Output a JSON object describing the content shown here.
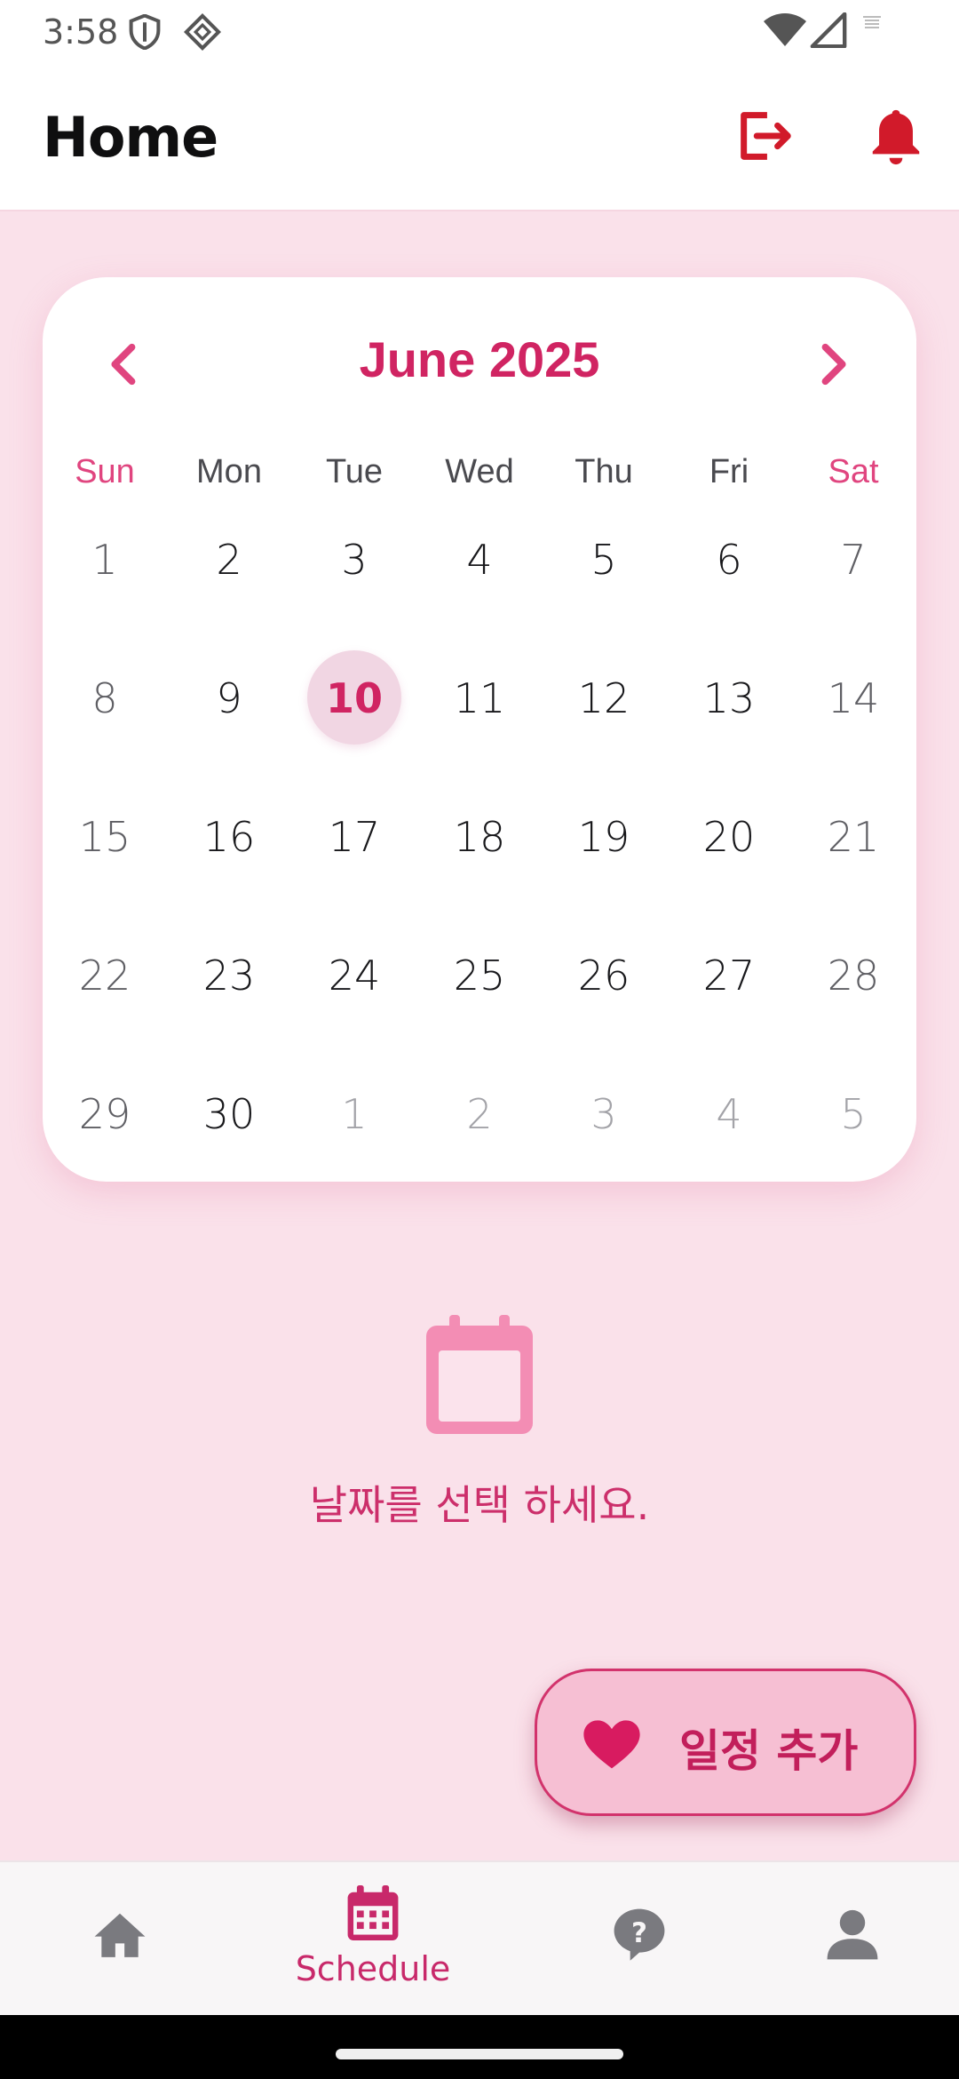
{
  "status_bar": {
    "time": "3:58",
    "icons": [
      "shield-icon",
      "diamond-icon",
      "wifi-icon",
      "signal-icon",
      "battery-icon"
    ]
  },
  "app_bar": {
    "title": "Home",
    "actions": [
      "logout-icon",
      "bell-icon"
    ],
    "action_color": "#d11a2a"
  },
  "calendar": {
    "month_title": "June 2025",
    "weekdays": [
      "Sun",
      "Mon",
      "Tue",
      "Wed",
      "Thu",
      "Fri",
      "Sat"
    ],
    "weeks": [
      [
        "1",
        "2",
        "3",
        "4",
        "5",
        "6",
        "7"
      ],
      [
        "8",
        "9",
        "10",
        "11",
        "12",
        "13",
        "14"
      ],
      [
        "15",
        "16",
        "17",
        "18",
        "19",
        "20",
        "21"
      ],
      [
        "22",
        "23",
        "24",
        "25",
        "26",
        "27",
        "28"
      ],
      [
        "29",
        "30",
        "1",
        "2",
        "3",
        "4",
        "5"
      ]
    ],
    "selected_day": "10",
    "accent_color": "#d02462",
    "weekend_color": "#e0457f"
  },
  "empty_state": {
    "icon": "calendar-icon",
    "message": "날짜를 선택 하세요."
  },
  "fab": {
    "icon": "heart-icon",
    "label": "일정 추가"
  },
  "bottom_nav": {
    "items": [
      {
        "icon": "home-icon",
        "label": ""
      },
      {
        "icon": "calendar-icon",
        "label": "Schedule"
      },
      {
        "icon": "question-bubble-icon",
        "label": ""
      },
      {
        "icon": "person-icon",
        "label": ""
      }
    ],
    "active_index": 1,
    "active_color": "#c8296a",
    "inactive_color": "#7a7a7f"
  }
}
